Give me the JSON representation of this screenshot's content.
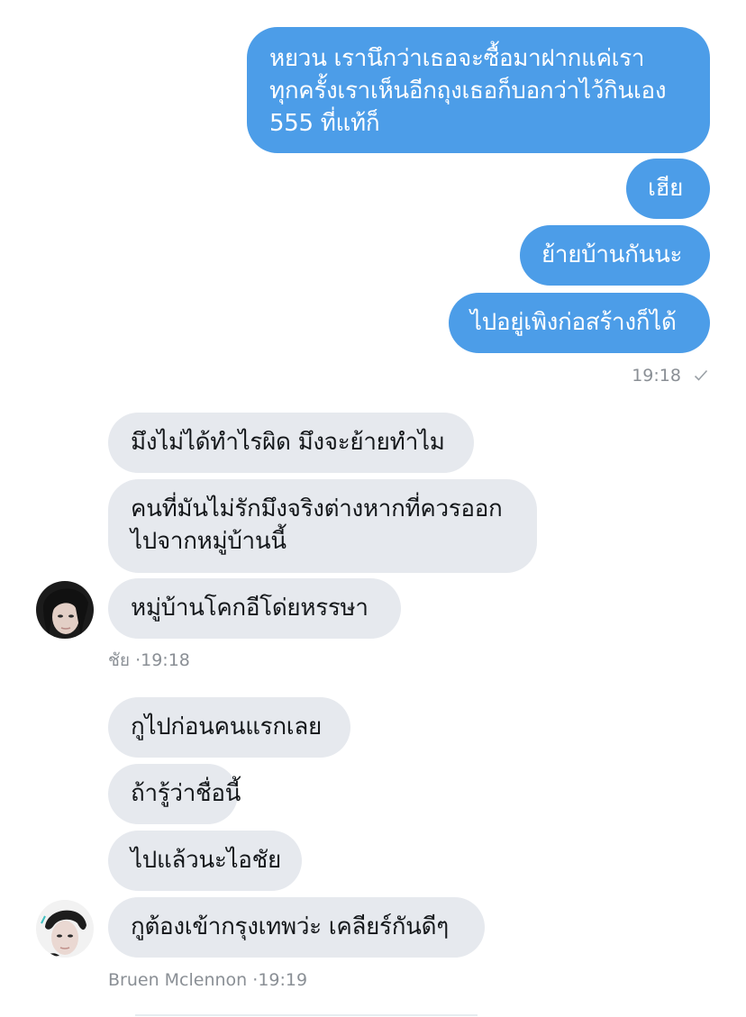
{
  "conversation": {
    "outgoing_group": {
      "messages": [
        {
          "lines": [
            "หยวน เรานึกว่าเธอจะซื้อมาฝากแค่เรา",
            "ทุกครั้งเราเห็นอีกถุงเธอก็บอกว่าไว้กินเอง",
            "555 ที่แท้ก็"
          ]
        },
        {
          "lines": [
            "เฮีย"
          ]
        },
        {
          "lines": [
            "ย้ายบ้านกันนะ"
          ]
        },
        {
          "lines": [
            "ไปอยู่เพิงก่อสร้างก็ได้"
          ]
        }
      ],
      "time": "19:18",
      "status_icon": "check-icon"
    },
    "incoming_group_1": {
      "messages": [
        {
          "lines": [
            "มึงไม่ได้ทำไรผิด มึงจะย้ายทำไม"
          ]
        },
        {
          "lines": [
            "คนที่มันไม่รักมึงจริงต่างหากที่ควรออก",
            "ไปจากหมู่บ้านนี้"
          ]
        },
        {
          "lines": [
            "หมู่บ้านโคกอีโด่ยหรรษา"
          ]
        }
      ],
      "sender": "ชัย",
      "separator": "·",
      "time": "19:18"
    },
    "incoming_group_2": {
      "messages": [
        {
          "lines": [
            "กูไปก่อนคนแรกเลย"
          ]
        },
        {
          "lines": [
            "ถ้ารู้ว่าชื่อนี้"
          ]
        },
        {
          "lines": [
            "ไปแล้วนะไอชัย"
          ]
        },
        {
          "lines": [
            "กูต้องเข้ากรุงเทพว่ะ เคลียร์กันดีๆ"
          ]
        }
      ],
      "sender": "Bruen Mclennon",
      "separator": "·",
      "time": "19:19"
    }
  },
  "colors": {
    "outgoing_bubble": "#4c9de8",
    "incoming_bubble": "#e6e9ee",
    "meta_text": "#8a8f95"
  }
}
